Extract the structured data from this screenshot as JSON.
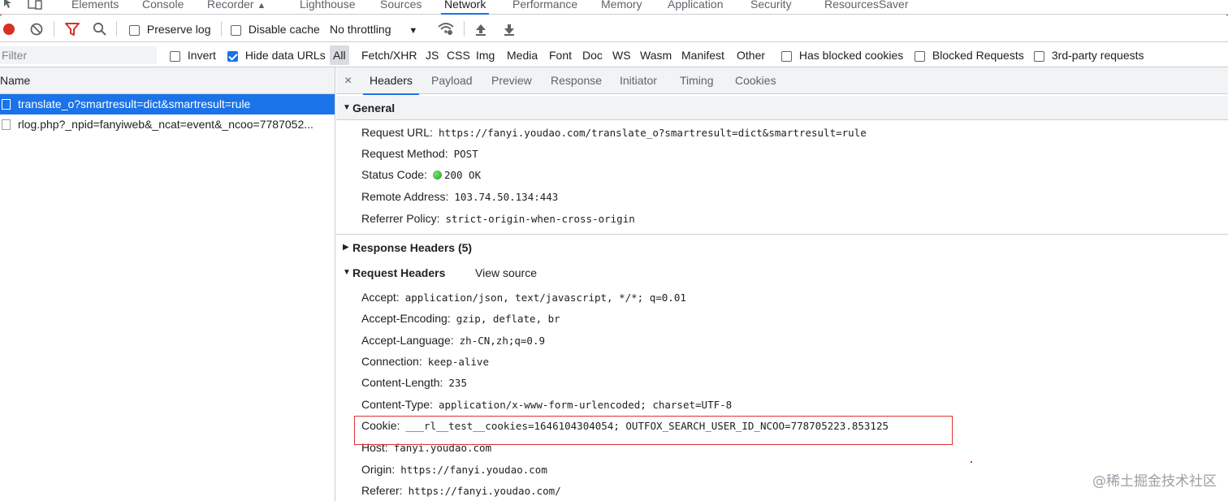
{
  "top_tabs": [
    "Elements",
    "Console",
    "Recorder",
    "Lighthouse",
    "Sources",
    "Network",
    "Performance",
    "Memory",
    "Application",
    "Security",
    "ResourcesSaver"
  ],
  "active_top_tab": "Network",
  "toolbar": {
    "preserve_log_label": "Preserve log",
    "preserve_log_checked": false,
    "disable_cache_label": "Disable cache",
    "disable_cache_checked": false,
    "throttling_value": "No throttling"
  },
  "filterbar": {
    "filter_placeholder": "Filter",
    "invert_label": "Invert",
    "hide_data_urls_label": "Hide data URLs",
    "types": [
      "All",
      "Fetch/XHR",
      "JS",
      "CSS",
      "Img",
      "Media",
      "Font",
      "Doc",
      "WS",
      "Wasm",
      "Manifest",
      "Other"
    ],
    "active_type": "All",
    "has_blocked_cookies_label": "Has blocked cookies",
    "blocked_requests_label": "Blocked Requests",
    "third_party_label": "3rd-party requests"
  },
  "request_list": {
    "header": "Name",
    "rows": [
      {
        "name": "translate_o?smartresult=dict&smartresult=rule",
        "selected": true
      },
      {
        "name": "rlog.php?_npid=fanyiweb&_ncat=event&_ncoo=7787052...",
        "selected": false
      }
    ]
  },
  "details": {
    "close_glyph": "×",
    "tabs": [
      "Headers",
      "Payload",
      "Preview",
      "Response",
      "Initiator",
      "Timing",
      "Cookies"
    ],
    "active_tab": "Headers",
    "general": {
      "title": "General",
      "request_url_label": "Request URL:",
      "request_url": "https://fanyi.youdao.com/translate_o?smartresult=dict&smartresult=rule",
      "request_method_label": "Request Method:",
      "request_method": "POST",
      "status_code_label": "Status Code:",
      "status_code": "200 OK",
      "remote_address_label": "Remote Address:",
      "remote_address": "103.74.50.134:443",
      "referrer_policy_label": "Referrer Policy:",
      "referrer_policy": "strict-origin-when-cross-origin"
    },
    "response_headers_title": "Response Headers (5)",
    "request_headers_title": "Request Headers",
    "view_source_label": "View source",
    "request_headers": [
      {
        "name": "Accept:",
        "value": "application/json, text/javascript, */*; q=0.01"
      },
      {
        "name": "Accept-Encoding:",
        "value": "gzip, deflate, br"
      },
      {
        "name": "Accept-Language:",
        "value": "zh-CN,zh;q=0.9"
      },
      {
        "name": "Connection:",
        "value": "keep-alive"
      },
      {
        "name": "Content-Length:",
        "value": "235"
      },
      {
        "name": "Content-Type:",
        "value": "application/x-www-form-urlencoded; charset=UTF-8"
      },
      {
        "name": "Cookie:",
        "value": "___rl__test__cookies=1646104304054; OUTFOX_SEARCH_USER_ID_NCOO=778705223.853125"
      },
      {
        "name": "Host:",
        "value": "fanyi.youdao.com"
      },
      {
        "name": "Origin:",
        "value": "https://fanyi.youdao.com"
      },
      {
        "name": "Referer:",
        "value": "https://fanyi.youdao.com/"
      }
    ]
  },
  "watermark": "@稀土掘金技术社区",
  "colors": {
    "accent": "#1a73e8",
    "record_red": "#d93025",
    "highlight_red": "#e0312f",
    "status_green": "#1e9e1a"
  },
  "icons": [
    "inspect-icon",
    "device-toggle-icon",
    "record-icon",
    "clear-icon",
    "filter-icon",
    "search-icon",
    "throttle-dropdown-icon",
    "network-conditions-icon",
    "import-har-icon",
    "export-har-icon",
    "expand-triangle-icon",
    "collapse-triangle-icon",
    "document-icon"
  ]
}
